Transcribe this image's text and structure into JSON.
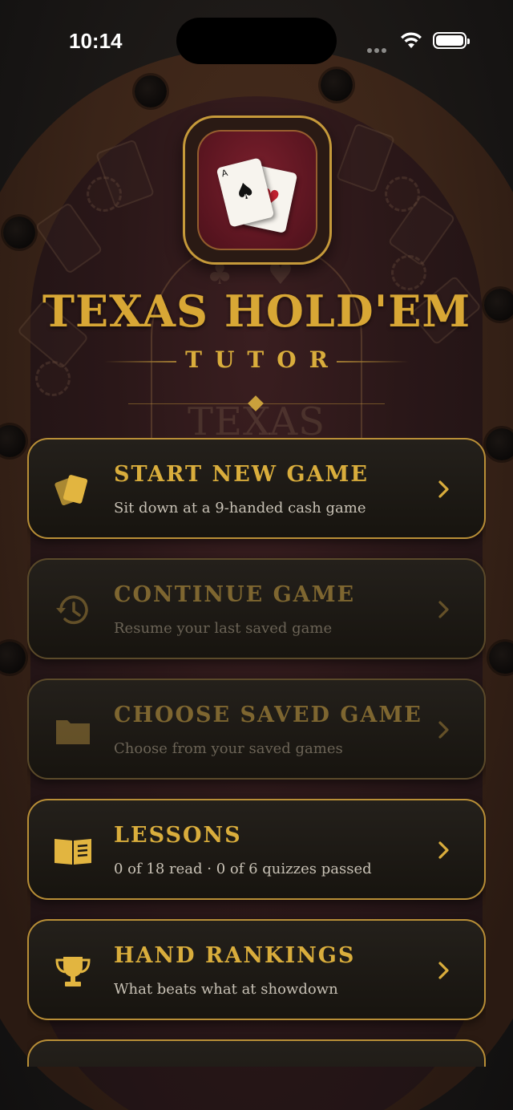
{
  "status_bar": {
    "time": "10:14"
  },
  "app": {
    "title": "TEXAS HOLD'EM",
    "subtitle": "TUTOR",
    "logo_cards": [
      {
        "rank": "A",
        "suit": "♠",
        "color": "#111111"
      },
      {
        "rank": "A",
        "suit": "♥",
        "color": "#c0202f"
      }
    ]
  },
  "colors": {
    "gold": "#d9ad3c",
    "border_gold": "#b98f37",
    "card_bg": "#1c1914",
    "felt": "#2a1718"
  },
  "menu": [
    {
      "title": "START NEW GAME",
      "subtitle": "Sit down at a 9-handed cash game",
      "icon": "cards-icon",
      "enabled": true
    },
    {
      "title": "CONTINUE GAME",
      "subtitle": "Resume your last saved game",
      "icon": "history-icon",
      "enabled": false
    },
    {
      "title": "CHOOSE SAVED GAME",
      "subtitle": "Choose from your saved games",
      "icon": "folder-icon",
      "enabled": false
    },
    {
      "title": "LESSONS",
      "subtitle": "0 of 18 read · 0 of 6 quizzes passed",
      "icon": "book-icon",
      "enabled": true
    },
    {
      "title": "HAND RANKINGS",
      "subtitle": "What beats what at showdown",
      "icon": "trophy-icon",
      "enabled": true
    }
  ]
}
